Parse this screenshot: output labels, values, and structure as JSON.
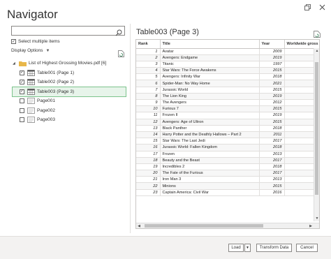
{
  "window": {
    "title": "Navigator",
    "restore_icon": "restore-icon",
    "close_icon": "close-icon"
  },
  "left": {
    "search": {
      "value": "",
      "placeholder": ""
    },
    "select_multiple": {
      "label": "Select multiple items",
      "checked": true
    },
    "display_options": "Display Options",
    "tree": [
      {
        "label": "List of Highest Grossing Movies.pdf [6]",
        "type": "folder",
        "level": 0,
        "checked": null,
        "expanded": true,
        "selected": false
      },
      {
        "label": "Table001 (Page 1)",
        "type": "table",
        "level": 1,
        "checked": true,
        "selected": false
      },
      {
        "label": "Table002 (Page 2)",
        "type": "table",
        "level": 1,
        "checked": true,
        "selected": false
      },
      {
        "label": "Table003 (Page 3)",
        "type": "table",
        "level": 1,
        "checked": true,
        "selected": true
      },
      {
        "label": "Page001",
        "type": "page",
        "level": 1,
        "checked": false,
        "selected": false
      },
      {
        "label": "Page002",
        "type": "page",
        "level": 1,
        "checked": false,
        "selected": false
      },
      {
        "label": "Page003",
        "type": "page",
        "level": 1,
        "checked": false,
        "selected": false
      }
    ]
  },
  "preview": {
    "title": "Table003 (Page 3)",
    "columns": [
      "Rank",
      "Title",
      "Year",
      "Worldwide gross"
    ],
    "rows": [
      [
        "1",
        "Avatar",
        "2009",
        ""
      ],
      [
        "2",
        "Avengers: Endgame",
        "2019",
        ""
      ],
      [
        "3",
        "Titanic",
        "1997",
        ""
      ],
      [
        "4",
        "Star Wars: The Force Awakens",
        "2015",
        ""
      ],
      [
        "5",
        "Avengers: Infinity War",
        "2018",
        ""
      ],
      [
        "6",
        "Spider-Man: No Way Home",
        "2021",
        ""
      ],
      [
        "7",
        "Jurassic World",
        "2015",
        ""
      ],
      [
        "8",
        "The Lion King",
        "2019",
        ""
      ],
      [
        "9",
        "The Avengers",
        "2012",
        ""
      ],
      [
        "10",
        "Furious 7",
        "2015",
        ""
      ],
      [
        "11",
        "Frozen II",
        "2019",
        ""
      ],
      [
        "12",
        "Avengers: Age of Ultron",
        "2015",
        ""
      ],
      [
        "13",
        "Black Panther",
        "2018",
        ""
      ],
      [
        "14",
        "Harry Potter and the Deathly Hallows – Part 2",
        "2011",
        ""
      ],
      [
        "15",
        "Star Wars: The Last Jedi",
        "2017",
        ""
      ],
      [
        "16",
        "Jurassic World: Fallen Kingdom",
        "2018",
        ""
      ],
      [
        "17",
        "Frozen",
        "2013",
        ""
      ],
      [
        "18",
        "Beauty and the Beast",
        "2017",
        ""
      ],
      [
        "19",
        "Incredibles 2",
        "2018",
        ""
      ],
      [
        "20",
        "The Fate of the Furious",
        "2017",
        ""
      ],
      [
        "21",
        "Iron Man 3",
        "2013",
        ""
      ],
      [
        "22",
        "Minions",
        "2015",
        ""
      ],
      [
        "23",
        "Captain America: Civil War",
        "2016",
        ""
      ]
    ]
  },
  "footer": {
    "load": "Load",
    "transform": "Transform Data",
    "cancel": "Cancel"
  },
  "colors": {
    "selection_bg": "#e7f4ea",
    "selection_border": "#7cc38c",
    "footer_bg": "#f3f2f1"
  }
}
